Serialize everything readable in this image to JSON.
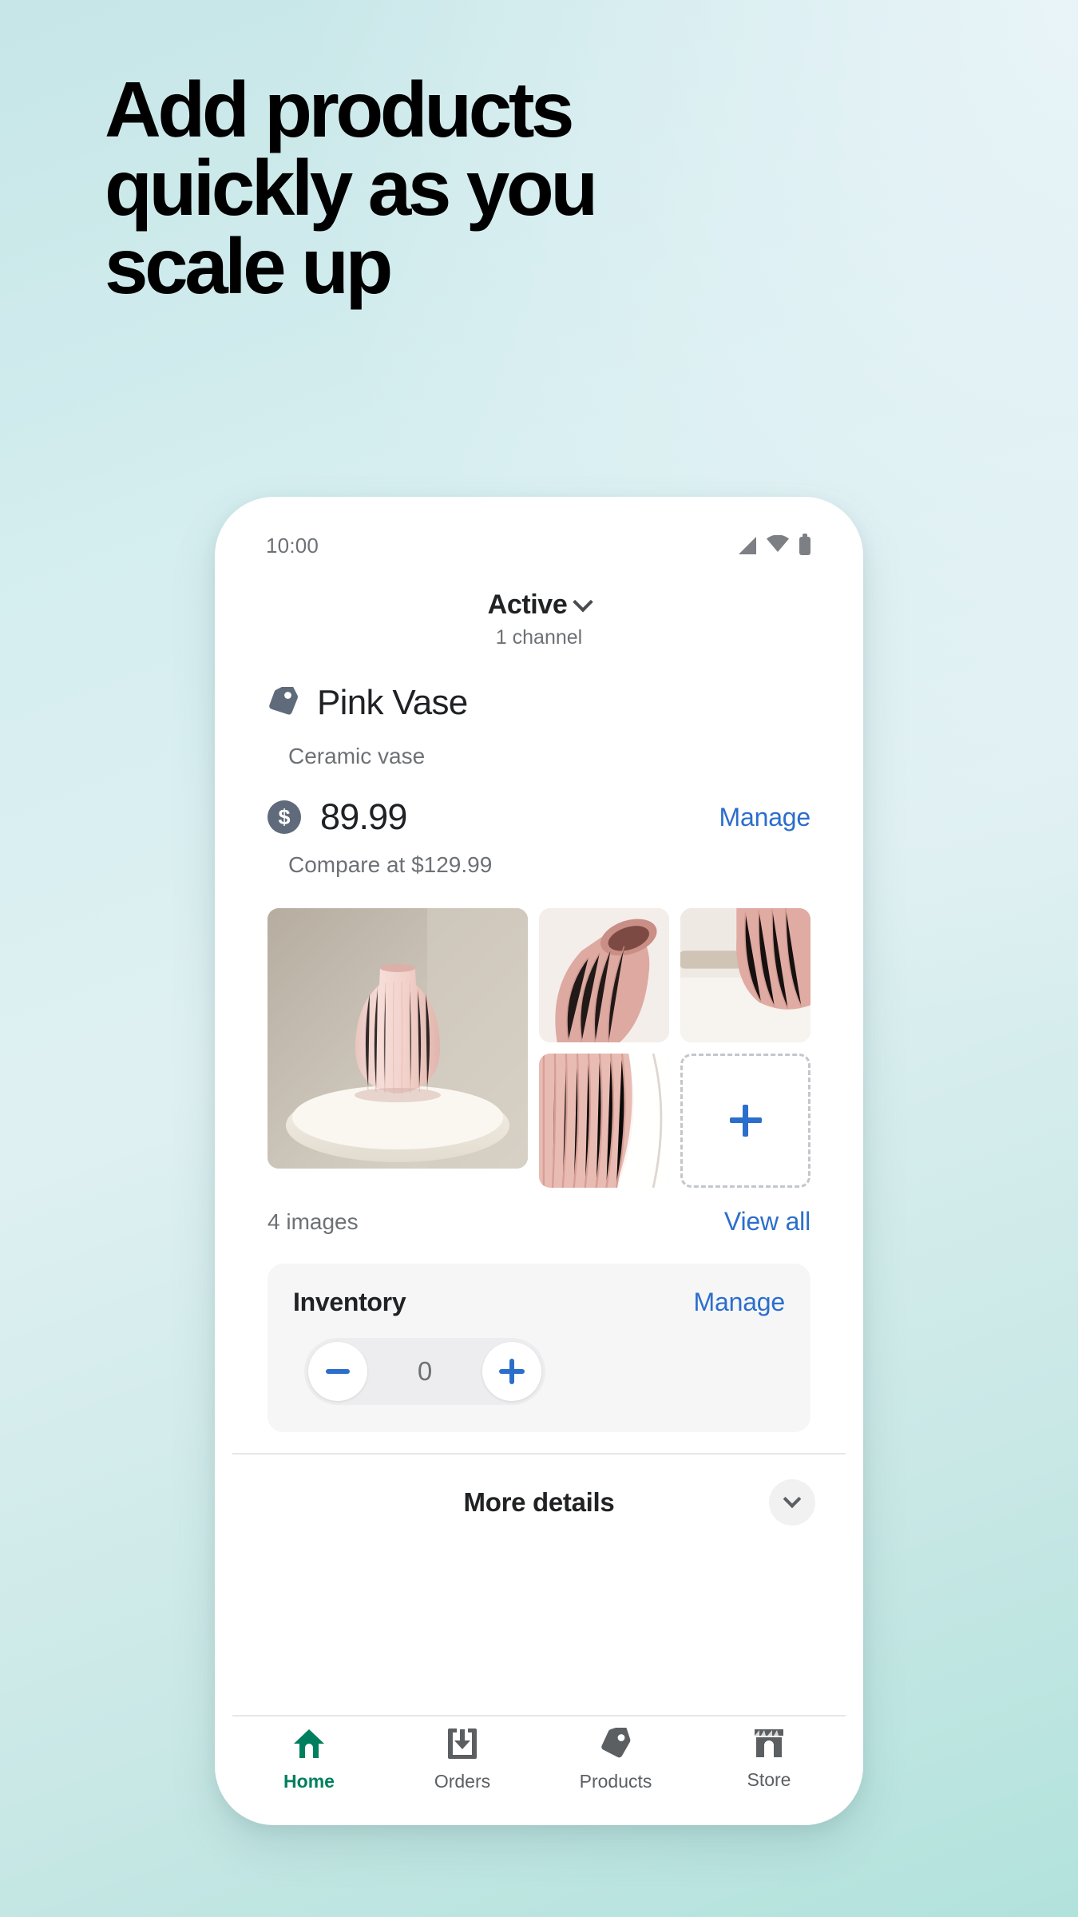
{
  "headline": "Add products\nquickly as you\nscale up",
  "theme": {
    "bg_top_left": "#c6e6e7",
    "bg_top_right": "#e9f4f8",
    "bg_bottom": "#b2e2dc",
    "link_blue": "#2c6ecb",
    "accent_green": "#007f5f",
    "muted_text": "#6d7175",
    "dark_text": "#202223"
  },
  "phone": {
    "statusbar": {
      "time": "10:00",
      "icons": [
        "signal-icon",
        "wifi-icon",
        "battery-icon"
      ]
    },
    "channel_header": {
      "status": "Active",
      "chevron": "chevron-down-icon",
      "subtitle": "1 channel"
    },
    "product": {
      "tag_icon": "tag-icon",
      "title": "Pink Vase",
      "subtitle": "Ceramic vase",
      "price_badge": "$",
      "price": "89.99",
      "price_manage_label": "Manage",
      "compare_at": "Compare at $129.99"
    },
    "gallery": {
      "image_count_label": "4 images",
      "view_all_label": "View all",
      "add_icon": "plus-icon",
      "thumbs": [
        {
          "alt": "pink ribbed vase on white table",
          "role": "main"
        },
        {
          "alt": "vase opening top view",
          "role": "thumb"
        },
        {
          "alt": "vase base close up",
          "role": "thumb"
        },
        {
          "alt": "vase ribbed texture detail",
          "role": "thumb"
        },
        {
          "alt": "add image placeholder",
          "role": "add"
        }
      ]
    },
    "inventory": {
      "title": "Inventory",
      "manage_label": "Manage",
      "decrement_icon": "minus-icon",
      "increment_icon": "plus-icon",
      "quantity": "0"
    },
    "more_details": {
      "label": "More details",
      "chevron_icon": "chevron-down-icon"
    },
    "bottom_nav": [
      {
        "label": "Home",
        "icon": "home-icon",
        "active": true
      },
      {
        "label": "Orders",
        "icon": "orders-inbox-icon",
        "active": false
      },
      {
        "label": "Products",
        "icon": "tag-icon",
        "active": false
      },
      {
        "label": "Store",
        "icon": "storefront-icon",
        "active": false
      }
    ]
  }
}
